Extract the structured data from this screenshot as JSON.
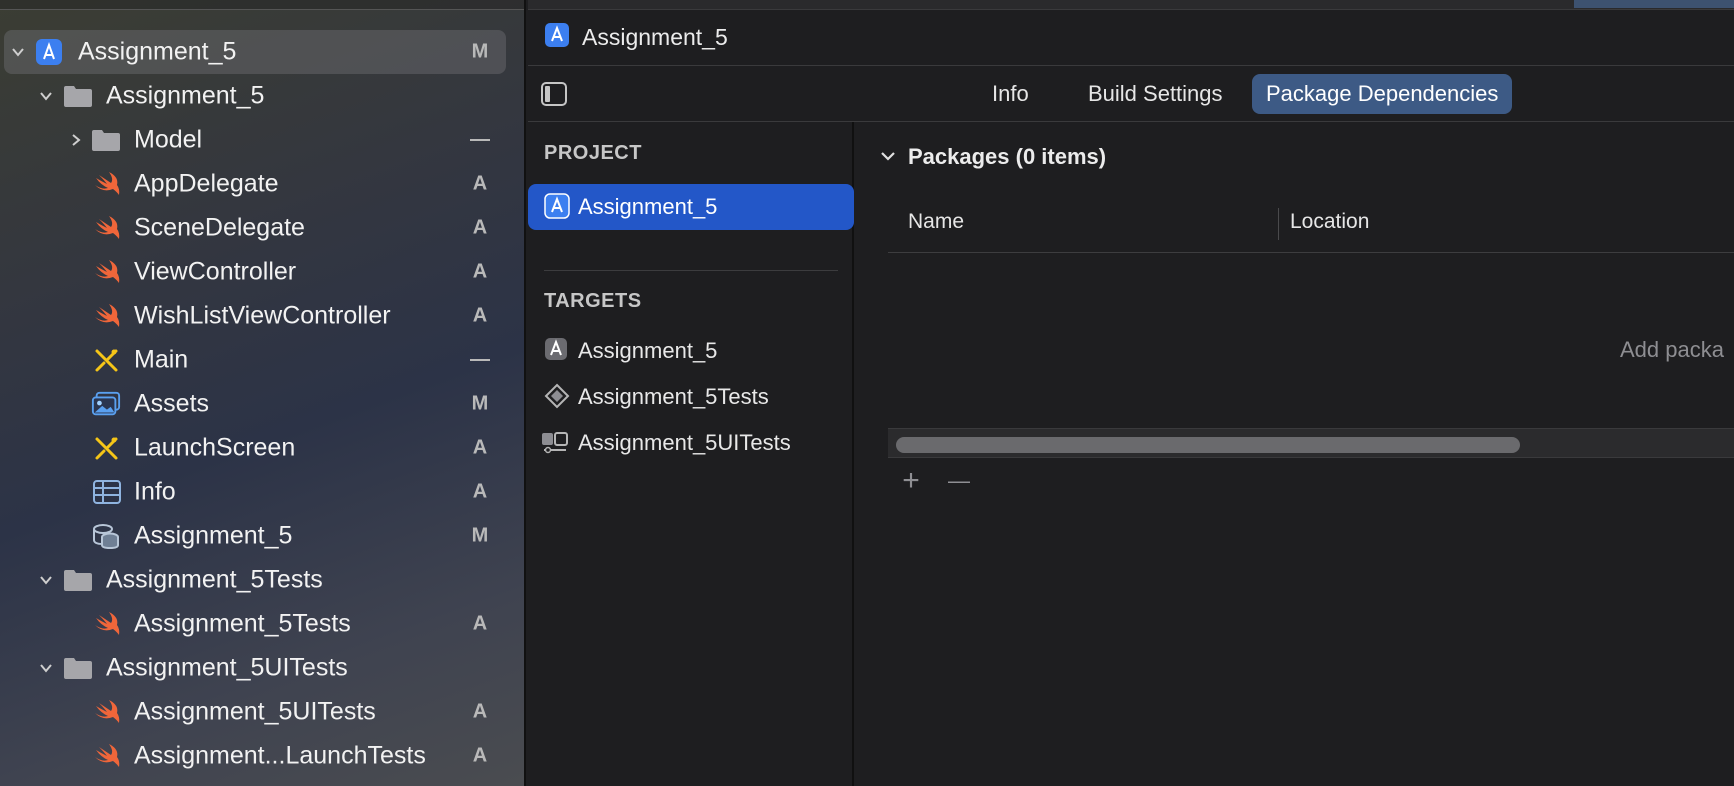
{
  "navigator": {
    "rows": [
      {
        "label": "Assignment_5",
        "status": "M",
        "kind": "project",
        "expanded": true
      },
      {
        "label": "Assignment_5",
        "status": "",
        "kind": "folder",
        "expanded": true
      },
      {
        "label": "Model",
        "status": "—",
        "kind": "folder",
        "expanded": false
      },
      {
        "label": "AppDelegate",
        "status": "A",
        "kind": "swift"
      },
      {
        "label": "SceneDelegate",
        "status": "A",
        "kind": "swift"
      },
      {
        "label": "ViewController",
        "status": "A",
        "kind": "swift"
      },
      {
        "label": "WishListViewController",
        "status": "A",
        "kind": "swift"
      },
      {
        "label": "Main",
        "status": "—",
        "kind": "storyboard"
      },
      {
        "label": "Assets",
        "status": "M",
        "kind": "assets"
      },
      {
        "label": "LaunchScreen",
        "status": "A",
        "kind": "storyboard"
      },
      {
        "label": "Info",
        "status": "A",
        "kind": "plist"
      },
      {
        "label": "Assignment_5",
        "status": "M",
        "kind": "coredata"
      },
      {
        "label": "Assignment_5Tests",
        "status": "",
        "kind": "folder",
        "expanded": true
      },
      {
        "label": "Assignment_5Tests",
        "status": "A",
        "kind": "swift"
      },
      {
        "label": "Assignment_5UITests",
        "status": "",
        "kind": "folder",
        "expanded": true
      },
      {
        "label": "Assignment_5UITests",
        "status": "A",
        "kind": "swift"
      },
      {
        "label": "Assignment...LaunchTests",
        "status": "A",
        "kind": "swift"
      }
    ]
  },
  "editor": {
    "jump_title": "Assignment_5",
    "tabs": [
      {
        "label": "Info",
        "active": false
      },
      {
        "label": "Build Settings",
        "active": false
      },
      {
        "label": "Package Dependencies",
        "active": true
      }
    ],
    "outline": {
      "project_header": "PROJECT",
      "project_item": "Assignment_5",
      "targets_header": "TARGETS",
      "targets": [
        "Assignment_5",
        "Assignment_5Tests",
        "Assignment_5UITests"
      ]
    },
    "packages": {
      "header": "Packages (0 items)",
      "columns": [
        "Name",
        "Location"
      ],
      "empty_message": "Add packa",
      "add_label": "+",
      "remove_label": "—"
    }
  },
  "colors": {
    "selection_blue": "#2357c8",
    "active_tab": "#3d5a85",
    "swift_orange": "#f0663a",
    "storyboard_yellow": "#f5c518"
  }
}
